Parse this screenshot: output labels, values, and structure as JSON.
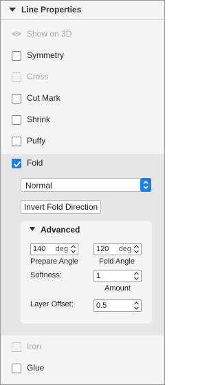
{
  "panel": {
    "title": "Line Properties"
  },
  "rows": {
    "show3d": "Show on 3D",
    "symmetry": "Symmetry",
    "cross": "Cross",
    "cutmark": "Cut Mark",
    "shrink": "Shrink",
    "puffy": "Puffy",
    "fold": "Fold",
    "iron": "Iron",
    "glue": "Glue"
  },
  "fold": {
    "type_value": "Normal",
    "invert_button": "Invert Fold Direction",
    "advanced_title": "Advanced",
    "prepare_angle_value": "140",
    "prepare_angle_unit": "deg",
    "prepare_angle_label": "Prepare Angle",
    "fold_angle_value": "120",
    "fold_angle_unit": "deg",
    "fold_angle_label": "Fold Angle",
    "softness_label": "Softness:",
    "softness_value": "1",
    "amount_label": "Amount",
    "layer_offset_label": "Layer Offset:",
    "layer_offset_value": "0.5"
  },
  "states": {
    "show3d_disabled": true,
    "cross_disabled": true,
    "iron_disabled": true,
    "fold_checked": true
  },
  "colors": {
    "accent": "#1f7fe0",
    "disabled_text": "#a8a8a8",
    "panel_bg": "#f4f4f4",
    "fold_bg": "#e6e6e6"
  },
  "icons": {
    "header_toggle": "triangle-down-icon",
    "show3d": "eye-icon",
    "fold_check": "checkmark-icon",
    "select_spinner": "up-down-arrows-icon",
    "field_spinner": "up-down-chevrons-icon"
  }
}
